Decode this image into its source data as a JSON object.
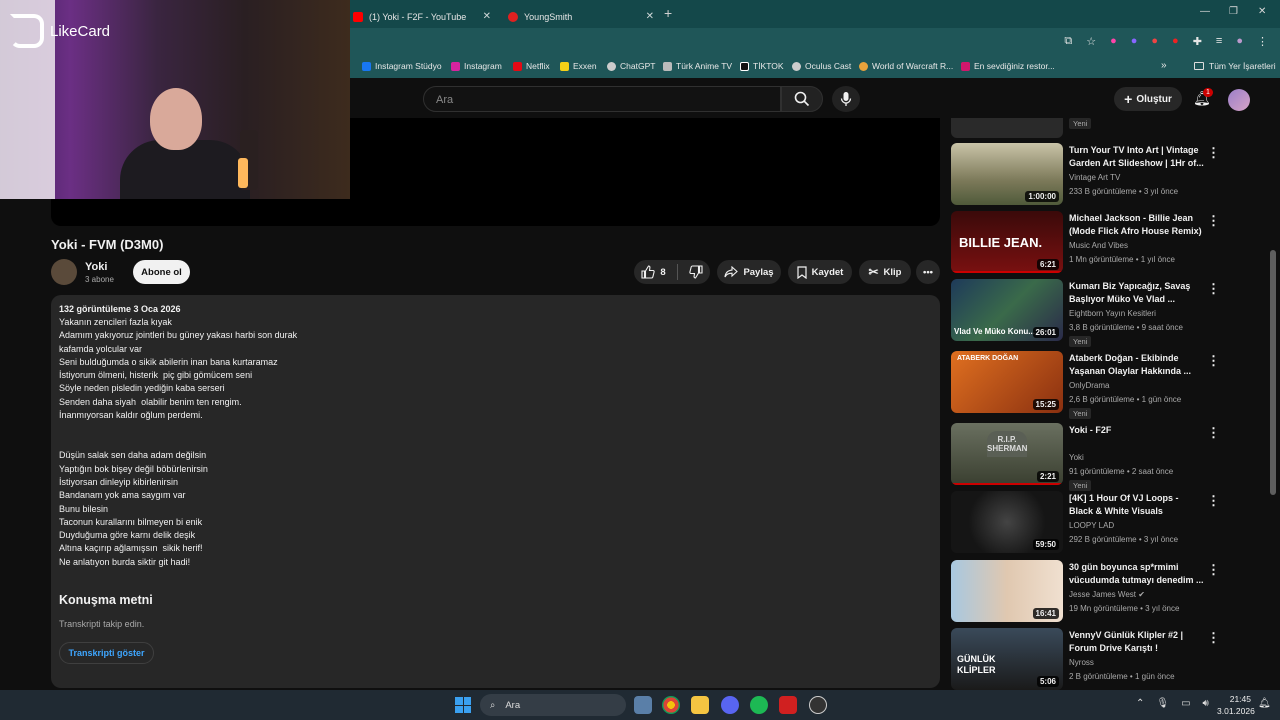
{
  "browser": {
    "tabs": [
      {
        "label": "(1) Yoki - F2F - YouTube",
        "color": "#ff0000"
      },
      {
        "label": "YoungSmith",
        "color": "#e02020"
      }
    ],
    "new_tab": "+",
    "window_controls": [
      "—",
      "❐",
      "✕"
    ],
    "bookmarks": [
      {
        "label": "Instagram Stüdyo",
        "color": "#1877f2"
      },
      {
        "label": "Instagram",
        "color": "#d6249f"
      },
      {
        "label": "Netflix",
        "color": "#e50914"
      },
      {
        "label": "Exxen",
        "color": "#f7d117"
      },
      {
        "label": "ChatGPT",
        "color": "#cccccc"
      },
      {
        "label": "Türk Anime TV",
        "color": "#bbbbbb"
      },
      {
        "label": "TİKTOK",
        "color": "#111111"
      },
      {
        "label": "Oculus Cast",
        "color": "#cccccc"
      },
      {
        "label": "World of Warcraft R...",
        "color": "#e8a33c"
      },
      {
        "label": "En sevdiğiniz restor...",
        "color": "#d0176c"
      }
    ],
    "all_bookmarks": "Tüm Yer İşaretleri"
  },
  "overlay": {
    "brand": "LikeCard"
  },
  "youtube": {
    "search_placeholder": "Ara",
    "create_label": "Oluştur",
    "notif_count": "1"
  },
  "video": {
    "title": "Yoki - FVM (D3M0)",
    "channel": "Yoki",
    "subscribers": "3 abone",
    "subscribe_label": "Abone ol",
    "likes": "8",
    "share_label": "Paylaş",
    "save_label": "Kaydet",
    "clip_label": "Klip",
    "views_date": "132 görüntüleme  3 Oca 2026",
    "lyrics_1": "Yakanın zencileri fazla kıyak\nAdamım yakıyoruz jointleri bu güney yakası harbi son durak\nkafamda yolcular var\nSeni bulduğumda o sikik abilerin inan bana kurtaramaz\nİstiyorum ölmeni, histerik  piç gibi gömücem seni\nSöyle neden pisledin yediğin kaba serseri\nSenden daha siyah  olabilir benim ten rengim.\nİnanmıyorsan kaldır oğlum perdemi.",
    "lyrics_2": "Düşün salak sen daha adam değilsin\nYaptığın bok bişey değil böbürlenirsin\nİstiyorsan dinleyip kibirlenirsin\nBandanam yok ama saygım var\nBunu bilesin\nTaconun kurallarını bilmeyen bi enik\nDuyduğuma göre karnı delik deşik\nAltına kaçırıp ağlamışsın  sikik herif!\nNe anlatıyon burda siktir git hadi!",
    "transcript_title": "Konuşma metni",
    "transcript_sub": "Transkripti takip edin.",
    "transcript_btn": "Transkripti göster"
  },
  "recommendations": [
    {
      "title": "",
      "channel": "",
      "meta": "",
      "badge": "Yeni",
      "duration": "",
      "thumb": "#2a2a2a"
    },
    {
      "title": "Turn Your TV Into Art | Vintage Garden Art Slideshow  | 1Hr of...",
      "channel": "Vintage Art TV",
      "meta": "233 B görüntüleme • 3 yıl önce",
      "badge": "",
      "duration": "1:00:00",
      "thumb": "#7d7a5a"
    },
    {
      "title": "Michael Jackson - Billie Jean (Mode Flick Afro House Remix)",
      "channel": "Music And Vibes",
      "meta": "1 Mn görüntüleme • 1 yıl önce",
      "badge": "",
      "duration": "6:21",
      "thumb": "#7a1010",
      "thumb_text": "BILLIE JEAN."
    },
    {
      "title": "Kumarı Biz Yapıcağız, Savaş Başlıyor Müko Ve Vlad ...",
      "channel": "Eightborn Yayın Kesitleri",
      "meta": "3,8 B görüntüleme • 9 saat önce",
      "badge": "Yeni",
      "duration": "26:01",
      "thumb": "#2a4a6a",
      "thumb_text": "Vlad Ve Müko Konu..."
    },
    {
      "title": "Ataberk Doğan - Ekibinde Yaşanan Olaylar Hakkında ...",
      "channel": "OnlyDrama",
      "meta": "2,6 B görüntüleme • 1 gün önce",
      "badge": "Yeni",
      "duration": "15:25",
      "thumb": "#c06010",
      "thumb_text": "ATABERK DOĞAN"
    },
    {
      "title": "Yoki - F2F",
      "channel": "Yoki",
      "meta": "91 görüntüleme • 2 saat önce",
      "badge": "Yeni",
      "duration": "2:21",
      "thumb": "#4a4f3a",
      "thumb_text": "R.I.P. SHERMAN"
    },
    {
      "title": "[4K] 1 Hour Of VJ Loops - Black & White Visuals",
      "channel": "LOOPY LAD",
      "meta": "292 B görüntüleme • 3 yıl önce",
      "badge": "",
      "duration": "59:50",
      "thumb": "#151515"
    },
    {
      "title": "30 gün boyunca sp*rmimi vücudumda tutmayı denedim ...",
      "channel": "Jesse James West",
      "meta": "19 Mn görüntüleme • 3 yıl önce",
      "badge": "",
      "duration": "16:41",
      "thumb": "#8ab0d0"
    },
    {
      "title": "VennyV Günlük Klipler #2 | Forum Drive Karıştı !",
      "channel": "Nyross",
      "meta": "2 B görüntüleme • 1 gün önce",
      "badge": "",
      "duration": "5:06",
      "thumb": "#2a3a4a",
      "thumb_text": "GÜNLÜK KLİPLER"
    }
  ],
  "taskbar": {
    "search": "Ara",
    "time": "21:45",
    "date": "3.01.2026"
  }
}
